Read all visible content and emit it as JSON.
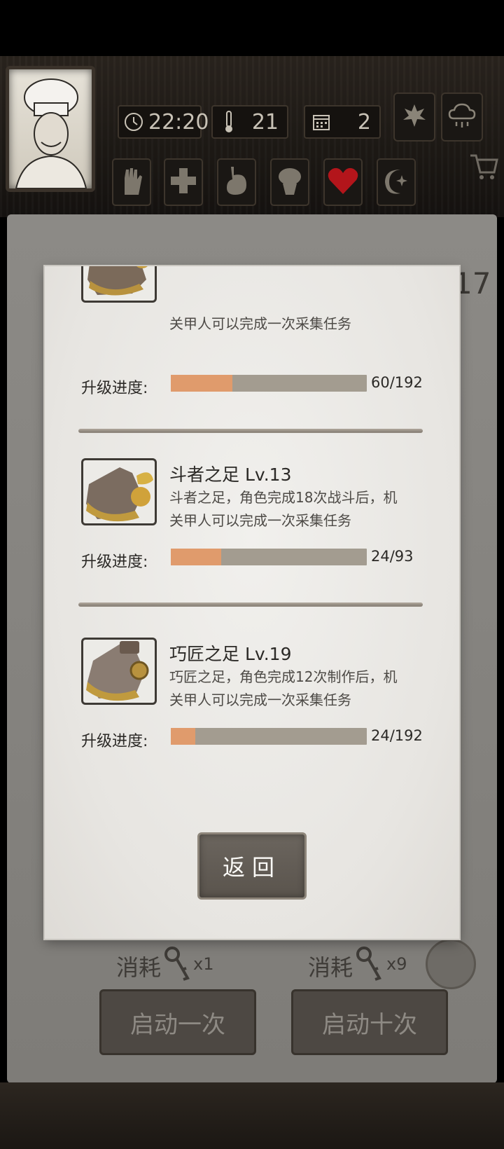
{
  "hud": {
    "time": "22:20",
    "temperature": "21",
    "day": "2",
    "condition_icons": [
      "hand-icon",
      "cross-icon",
      "stomach-icon",
      "brain-icon",
      "heart-icon",
      "moon-icon"
    ],
    "weather_icons": [
      "leaf-icon",
      "rain-icon"
    ],
    "heart_color": "#b3151b"
  },
  "background": {
    "count_badge": "17",
    "cost_single_label": "消耗",
    "cost_single_qty": "x1",
    "cost_ten_label": "消耗",
    "cost_ten_qty": "x9",
    "start_once_label": "启动一次",
    "start_ten_label": "启动十次"
  },
  "dialog": {
    "items": [
      {
        "title": "",
        "desc": "关甲人可以完成一次采集任务",
        "progress_label": "升级进度:",
        "progress_text": "60/192",
        "progress": 0.3125
      },
      {
        "title": "斗者之足  Lv.13",
        "desc": "斗者之足，角色完成18次战斗后，机关甲人可以完成一次采集任务",
        "progress_label": "升级进度:",
        "progress_text": "24/93",
        "progress": 0.258
      },
      {
        "title": "巧匠之足  Lv.19",
        "desc": "巧匠之足，角色完成12次制作后，机关甲人可以完成一次采集任务",
        "progress_label": "升级进度:",
        "progress_text": "24/192",
        "progress": 0.125
      }
    ],
    "back_label": "返回"
  }
}
